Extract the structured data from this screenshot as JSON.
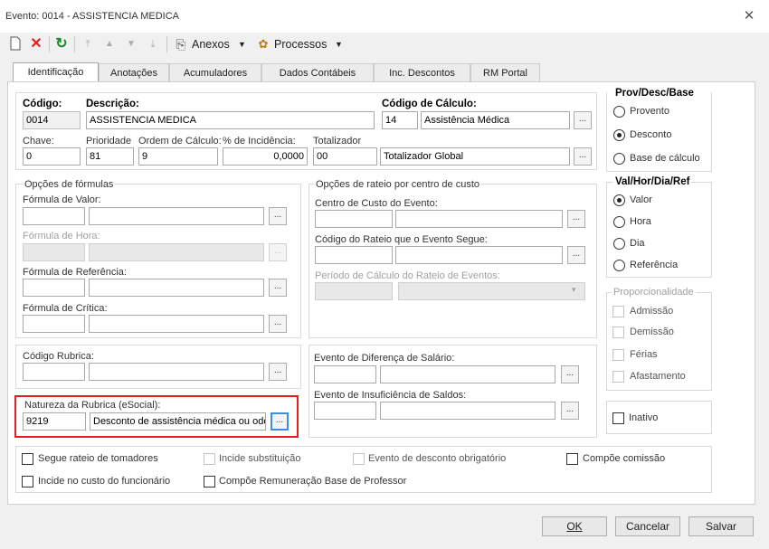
{
  "window": {
    "title": "Evento: 0014 - ASSISTENCIA MEDICA",
    "close": "✕"
  },
  "toolbar": {
    "anexos": "Anexos",
    "processos": "Processos"
  },
  "tabs": [
    "Identificação",
    "Anotações",
    "Acumuladores",
    "Dados Contábeis",
    "Inc. Descontos",
    "RM Portal"
  ],
  "ident": {
    "codigo_label": "Código:",
    "codigo": "0014",
    "descricao_label": "Descrição:",
    "descricao": "ASSISTENCIA MEDICA",
    "calc_label": "Código de Cálculo:",
    "calc_code": "14",
    "calc_desc": "Assistência Médica",
    "chave_label": "Chave:",
    "chave": "0",
    "prioridade_label": "Prioridade",
    "prioridade": "81",
    "ordem_label": "Ordem de Cálculo:",
    "ordem": "9",
    "incid_label": "% de Incidência:",
    "incid": "0,0000",
    "totalizador_label": "Totalizador",
    "totalizador_code": "00",
    "totalizador_desc": "Totalizador Global"
  },
  "formulas": {
    "title": "Opções de fórmulas",
    "valor": "Fórmula de Valor:",
    "hora": "Fórmula de Hora:",
    "referencia": "Fórmula de Referência:",
    "critica": "Fórmula de Crítica:"
  },
  "rateio": {
    "title": "Opções de rateio por centro de custo",
    "centro": "Centro de Custo do Evento:",
    "codigo": "Código do Rateio que o Evento Segue:",
    "periodo": "Período de Cálculo do Rateio de Eventos:"
  },
  "rubrica": {
    "label": "Código Rubrica:"
  },
  "diferenca": {
    "label": "Evento de Diferença de Salário:"
  },
  "insuf": {
    "label": "Evento de Insuficiência de Saldos:"
  },
  "natureza": {
    "label": "Natureza da Rubrica (eSocial):",
    "code": "9219",
    "desc": "Desconto de assistência médica ou odo"
  },
  "prov": {
    "title": "Prov/Desc/Base",
    "options": [
      "Provento",
      "Desconto",
      "Base de cálculo"
    ],
    "selected": "Desconto"
  },
  "val": {
    "title": "Val/Hor/Dia/Ref",
    "options": [
      "Valor",
      "Hora",
      "Dia",
      "Referência"
    ],
    "selected": "Valor"
  },
  "prop": {
    "title": "Proporcionalidade",
    "options": [
      "Admissão",
      "Demissão",
      "Férias",
      "Afastamento"
    ]
  },
  "inativo": "Inativo",
  "checks": {
    "segue": "Segue rateio de tomadores",
    "subst": "Incide substituição",
    "obrig": "Evento de desconto obrigatório",
    "comissao": "Compõe comissão",
    "custo": "Incide no custo do funcionário",
    "professor": "Compõe Remuneração Base de Professor"
  },
  "buttons": {
    "ok": "OK",
    "cancelar": "Cancelar",
    "salvar": "Salvar"
  },
  "ellipsis": "..."
}
